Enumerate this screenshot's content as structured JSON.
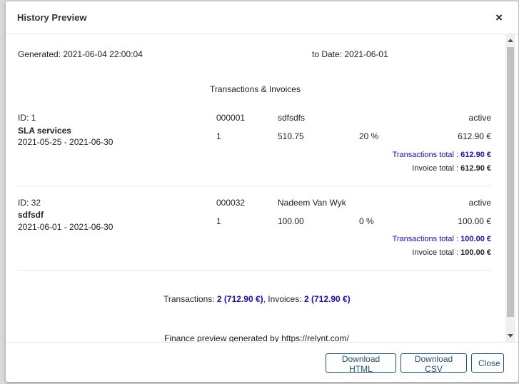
{
  "modal": {
    "title": "History Preview",
    "close_symbol": "×"
  },
  "report": {
    "generated": "Generated: 2021-06-04 22:00:04",
    "to_date": "to Date: 2021-06-01",
    "section_title": "Transactions & Invoices"
  },
  "entries": [
    {
      "id": "ID: 1",
      "number": "000001",
      "client": "sdfsdfs",
      "status": "active",
      "name": "SLA services",
      "period": "2021-05-25 - 2021-06-30",
      "qty": "1",
      "amount": "510.75",
      "tax": "20 %",
      "total": "612.90 €",
      "transactions_label": "Transactions total : ",
      "transactions_value": "612.90 €",
      "invoice_label": "Invoice total : ",
      "invoice_value": "612.90 €"
    },
    {
      "id": "ID: 32",
      "number": "000032",
      "client": "Nadeem Van Wyk",
      "status": "active",
      "name": "sdfsdf",
      "period": "2021-06-01 - 2021-06-30",
      "qty": "1",
      "amount": "100.00",
      "tax": "0 %",
      "total": "100.00 €",
      "transactions_label": "Transactions total : ",
      "transactions_value": "100.00 €",
      "invoice_label": "Invoice total : ",
      "invoice_value": "100.00 €"
    }
  ],
  "summary": {
    "transactions_label": "Transactions: ",
    "transactions_value": "2 (712.90 €)",
    "separator": ", Invoices: ",
    "invoices_value": "2 (712.90 €)"
  },
  "footer_note": "Finance preview generated by https://relynt.com/",
  "buttons": {
    "download_html": "Download HTML",
    "download_csv": "Download CSV",
    "close": "Close"
  }
}
